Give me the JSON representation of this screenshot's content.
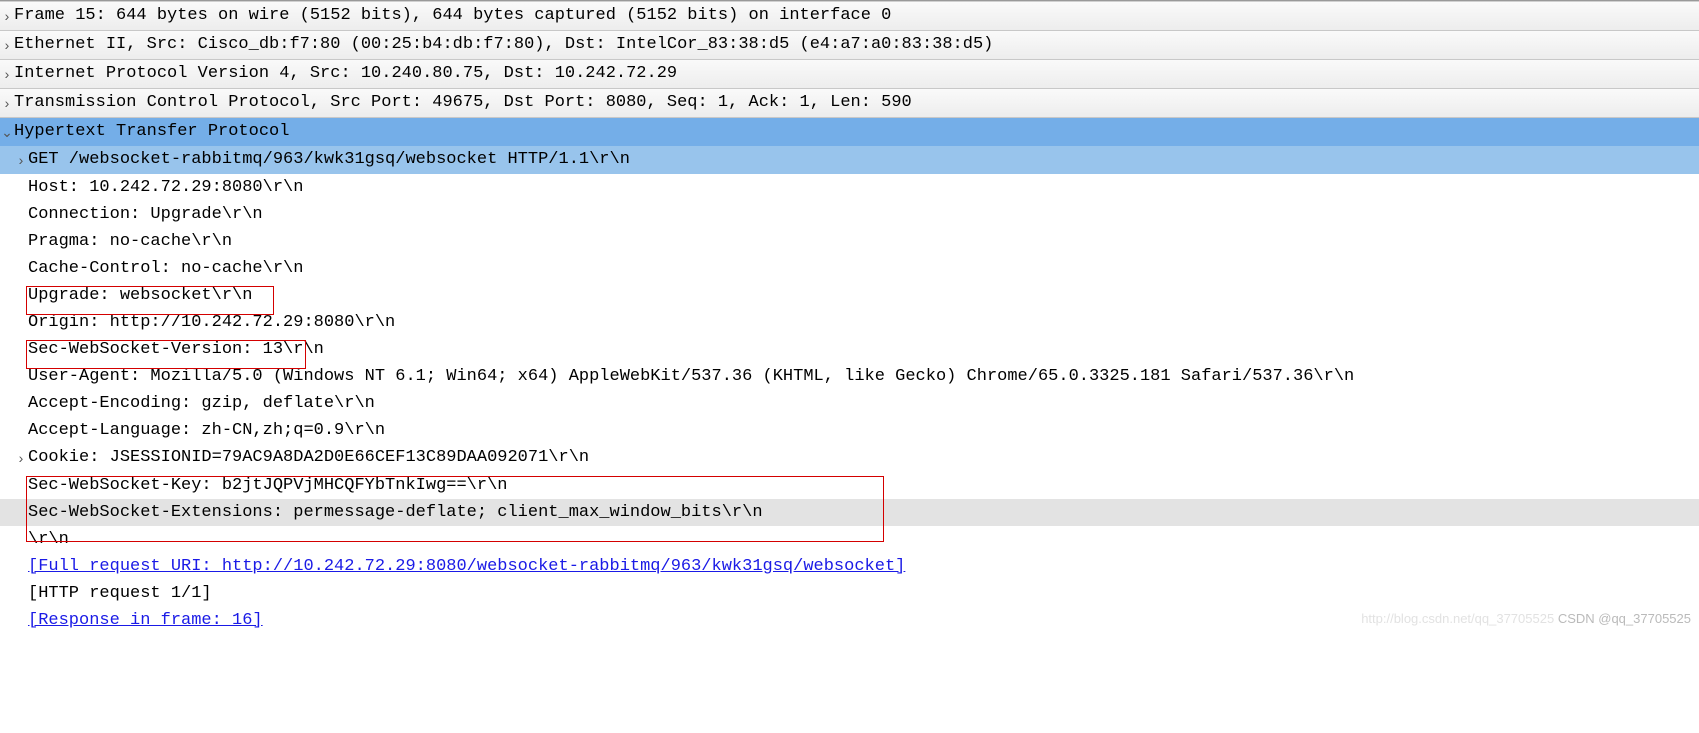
{
  "twisty": {
    "closed": "›",
    "open": "⌄"
  },
  "frame": "Frame 15: 644 bytes on wire (5152 bits), 644 bytes captured (5152 bits) on interface 0",
  "eth": "Ethernet II, Src: Cisco_db:f7:80 (00:25:b4:db:f7:80), Dst: IntelCor_83:38:d5 (e4:a7:a0:83:38:d5)",
  "ip": "Internet Protocol Version 4, Src: 10.240.80.75, Dst: 10.242.72.29",
  "tcp": "Transmission Control Protocol, Src Port: 49675, Dst Port: 8080, Seq: 1, Ack: 1, Len: 590",
  "http": "Hypertext Transfer Protocol",
  "reqline": "GET /websocket-rabbitmq/963/kwk31gsq/websocket HTTP/1.1\\r\\n",
  "headers": {
    "host": "Host: 10.242.72.29:8080\\r\\n",
    "connection": "Connection: Upgrade\\r\\n",
    "pragma": "Pragma: no-cache\\r\\n",
    "cachectrl": "Cache-Control: no-cache\\r\\n",
    "upgrade": "Upgrade: websocket\\r\\n",
    "origin": "Origin: http://10.242.72.29:8080\\r\\n",
    "wsver": "Sec-WebSocket-Version: 13\\r\\n",
    "ua": "User-Agent: Mozilla/5.0 (Windows NT 6.1; Win64; x64) AppleWebKit/537.36 (KHTML, like Gecko) Chrome/65.0.3325.181 Safari/537.36\\r\\n",
    "acceptenc": "Accept-Encoding: gzip, deflate\\r\\n",
    "acceptlang": "Accept-Language: zh-CN,zh;q=0.9\\r\\n",
    "cookie": "Cookie: JSESSIONID=79AC9A8DA2D0E66CEF13C89DAA092071\\r\\n",
    "wskey": "Sec-WebSocket-Key: b2jtJQPVjMHCQFYbTnkIwg==\\r\\n",
    "wsext": "Sec-WebSocket-Extensions: permessage-deflate; client_max_window_bits\\r\\n",
    "crlf": "\\r\\n"
  },
  "fulluri": "[Full request URI: http://10.242.72.29:8080/websocket-rabbitmq/963/kwk31gsq/websocket]",
  "reqnum": "[HTTP request 1/1]",
  "respframe": "[Response in frame: 16]",
  "watermark": {
    "faint": "http://blog.csdn.net/qq_37705525",
    "main": "CSDN @qq_37705525"
  }
}
